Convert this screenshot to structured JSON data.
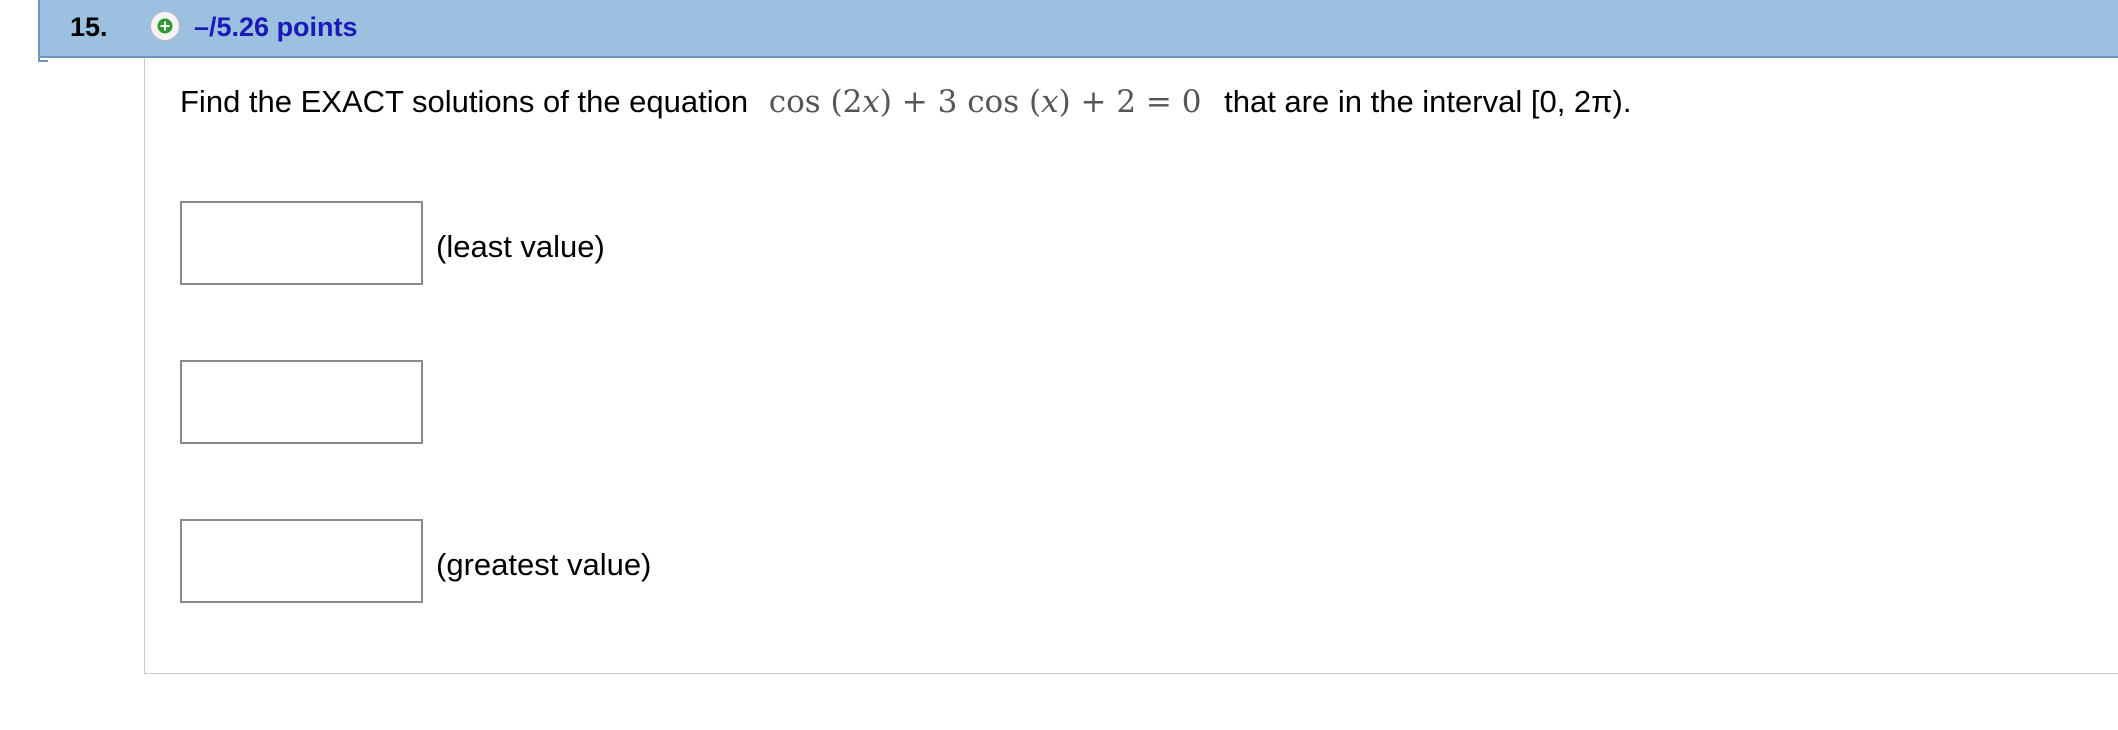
{
  "header": {
    "question_number": "15.",
    "points_label": "–/5.26 points",
    "plus_icon": "plus-circle-icon",
    "bar_color": "#9cc0e0",
    "points_color": "#1a1ab8"
  },
  "question": {
    "prefix": "Find the EXACT solutions of the equation",
    "equation": {
      "p1": "cos (2",
      "v1": "x",
      "p2": ") + 3 cos (",
      "v2": "x",
      "p3": ") + 2 = 0"
    },
    "suffix": "that are in the interval [0, 2π)."
  },
  "answers": [
    {
      "value": "",
      "label": "(least value)"
    },
    {
      "value": "",
      "label": ""
    },
    {
      "value": "",
      "label": "(greatest value)"
    }
  ]
}
